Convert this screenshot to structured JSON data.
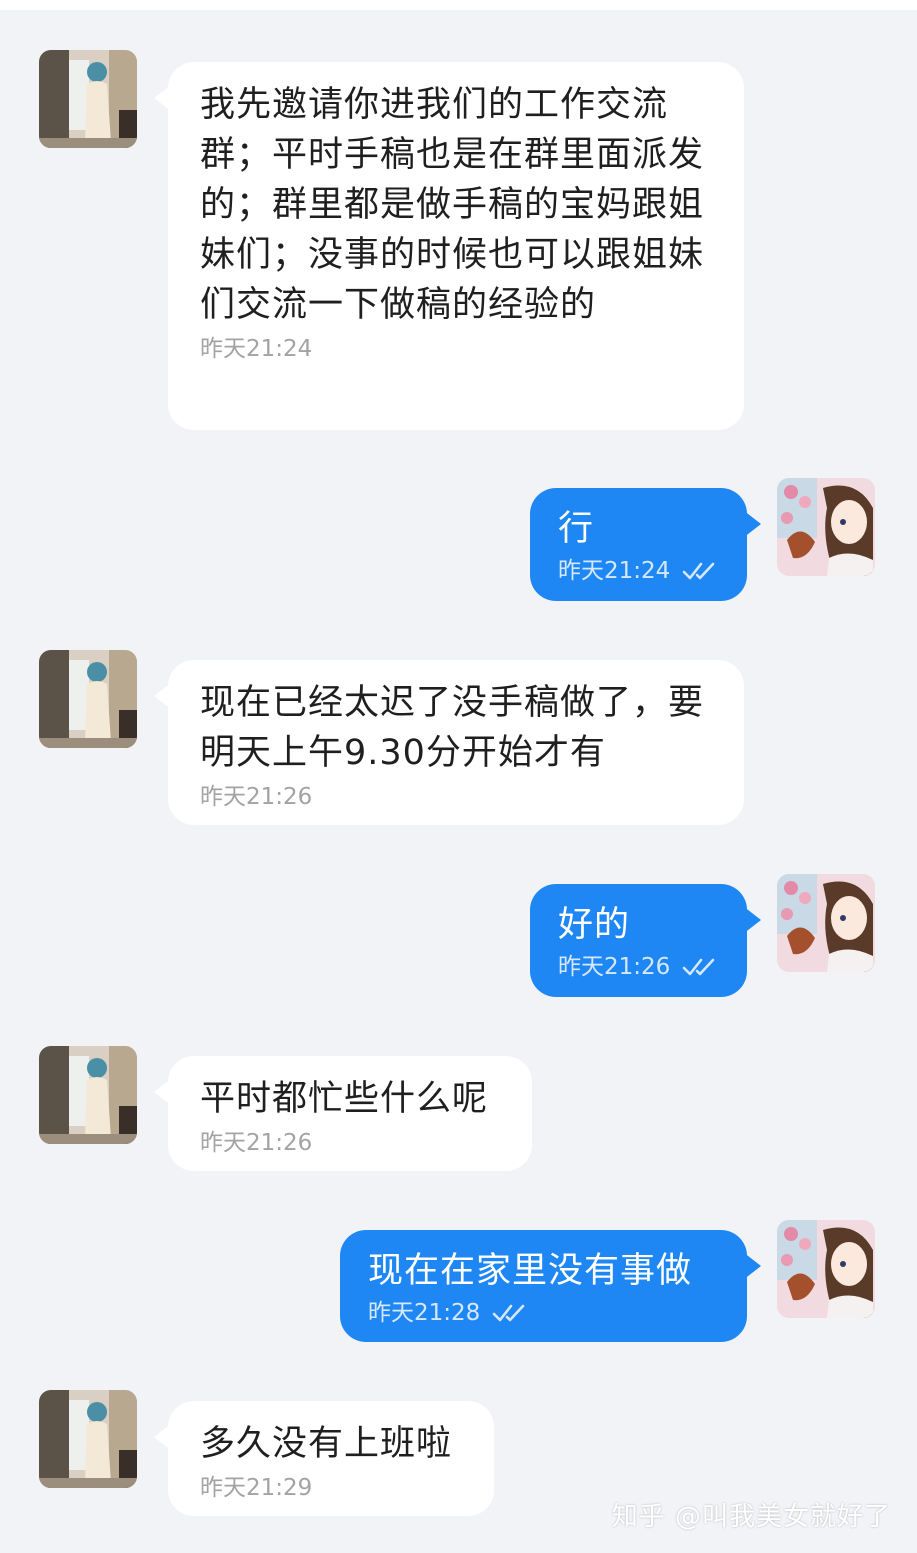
{
  "chat": {
    "messages": [
      {
        "side": "in",
        "text": "我先邀请你进我们的工作交流群；平时手稿也是在群里面派发的；群里都是做手稿的宝妈跟姐妹们；没事的时候也可以跟姐妹们交流一下做稿的经验的",
        "time": "昨天21:24"
      },
      {
        "side": "out",
        "text": "行",
        "time": "昨天21:24",
        "read": true
      },
      {
        "side": "in",
        "text": "现在已经太迟了没手稿做了，要明天上午9.30分开始才有",
        "time": "昨天21:26"
      },
      {
        "side": "out",
        "text": "好的",
        "time": "昨天21:26",
        "read": true
      },
      {
        "side": "in",
        "text": "平时都忙些什么呢",
        "time": "昨天21:26"
      },
      {
        "side": "out",
        "text": "现在在家里没有事做",
        "time": "昨天21:28",
        "read": true
      },
      {
        "side": "in",
        "text": "多久没有上班啦",
        "time": "昨天21:29"
      }
    ]
  },
  "watermark": "知乎 @叫我美女就好了",
  "colors": {
    "background": "#f1f3f6",
    "incoming_bubble": "#ffffff",
    "outgoing_bubble": "#1e87f3"
  },
  "icons": {
    "read_receipt": "double-check-icon"
  }
}
